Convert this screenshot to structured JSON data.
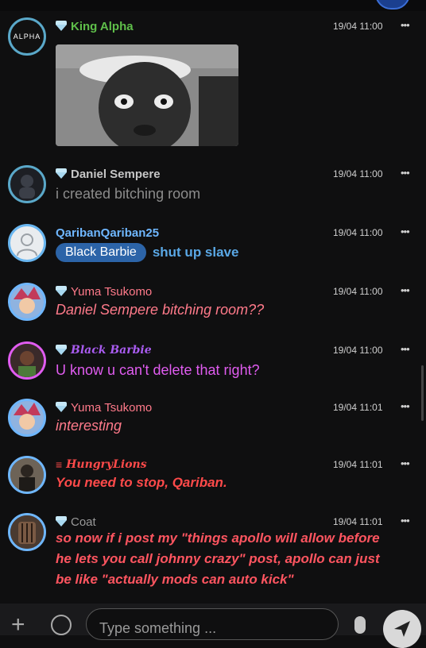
{
  "messages": [
    {
      "name": "King Alpha",
      "badge": "diamond-icon",
      "time": "19/04 11:00",
      "menu": "•••",
      "avatar_text": "ALPHA",
      "text": "",
      "has_image": true
    },
    {
      "name": "Daniel Sempere",
      "badge": "diamond-icon",
      "time": "19/04 11:00",
      "menu": "•••",
      "text": "i created bitching room"
    },
    {
      "name": "QaribanQariban25",
      "time": "19/04 11:00",
      "menu": "•••",
      "mention": "Black Barbie",
      "text": "shut up slave"
    },
    {
      "name": "Yuma Tsukomo",
      "badge": "diamond-icon",
      "time": "19/04 11:00",
      "menu": "•••",
      "text": "Daniel Sempere bitching room??"
    },
    {
      "name": "Black Barbie",
      "badge": "diamond-icon",
      "time": "19/04 11:00",
      "menu": "•••",
      "text": "U know u can't delete that right?"
    },
    {
      "name": "Yuma Tsukomo",
      "badge": "diamond-icon",
      "time": "19/04 11:01",
      "menu": "•••",
      "text": "interesting"
    },
    {
      "name": "HungryLions",
      "badge": "rank-bars-icon",
      "time": "19/04 11:01",
      "menu": "•••",
      "text": "You need to stop, Qariban."
    },
    {
      "name": "Coat",
      "badge": "diamond-icon",
      "time": "19/04 11:01",
      "menu": "•••",
      "text_lines": [
        "so now if i post my \"things apollo will allow before",
        "he lets you call johnny crazy\" post, apollo can just",
        "be like \"actually mods can auto kick\""
      ]
    }
  ],
  "composer": {
    "placeholder": "Type something ...",
    "plus": "+"
  },
  "colors": {
    "king": "#5fbf4a",
    "daniel": "#c6c6c6",
    "qariban": "#6fb7ff",
    "yuma": "#ff7a8a",
    "barbie": "#e05cf0",
    "hungry": "#ff4a4a",
    "coat": "#ff5560",
    "mention_bg": "#2c64a8"
  }
}
